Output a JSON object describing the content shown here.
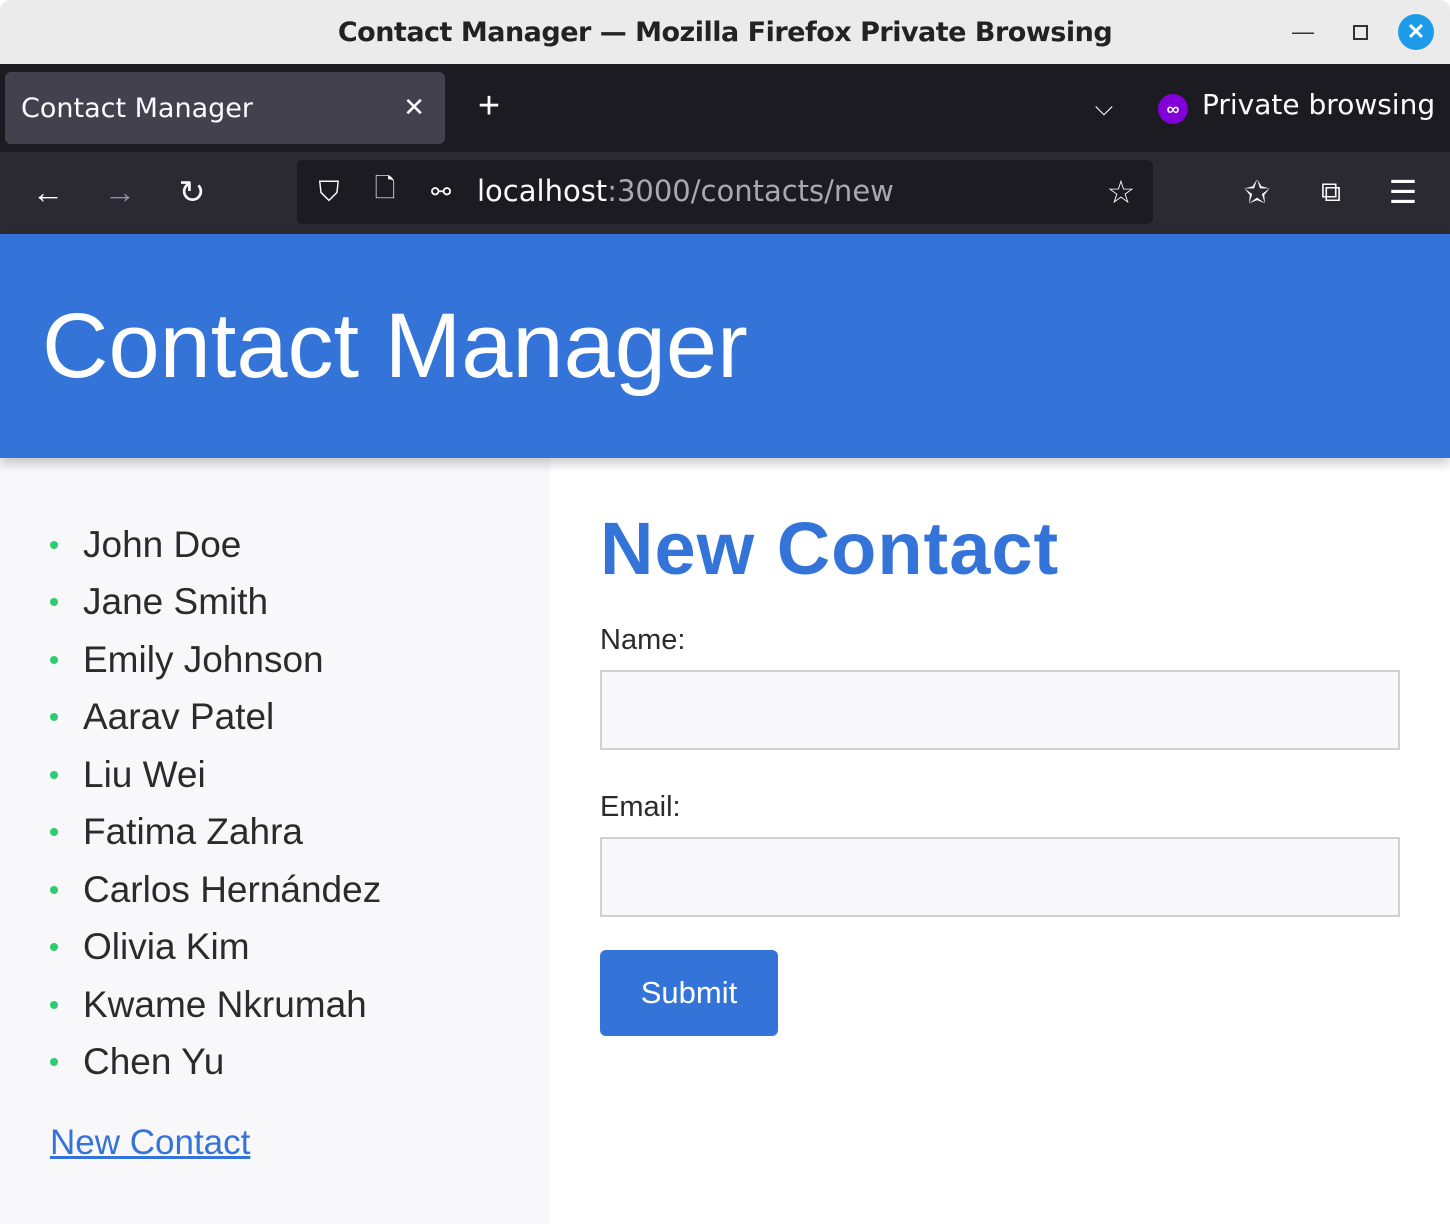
{
  "window": {
    "title": "Contact Manager — Mozilla Firefox Private Browsing"
  },
  "tab": {
    "label": "Contact Manager",
    "close": "✕",
    "new": "+"
  },
  "private": {
    "label": "Private browsing"
  },
  "url": {
    "host": "localhost",
    "rest": ":3000/contacts/new"
  },
  "header": {
    "title": "Contact Manager"
  },
  "contacts": [
    "John Doe",
    "Jane Smith",
    "Emily Johnson",
    "Aarav Patel",
    "Liu Wei",
    "Fatima Zahra",
    "Carlos Hernández",
    "Olivia Kim",
    "Kwame Nkrumah",
    "Chen Yu"
  ],
  "sidebar": {
    "new_link": "New Contact"
  },
  "form": {
    "title": "New Contact",
    "name_label": "Name:",
    "name_value": "",
    "email_label": "Email:",
    "email_value": "",
    "submit": "Submit"
  },
  "colors": {
    "accent": "#3474d8",
    "bullet": "#2ecc71"
  }
}
